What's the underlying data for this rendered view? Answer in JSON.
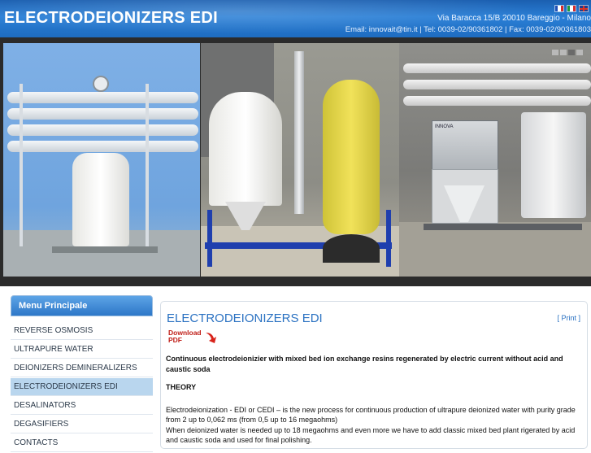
{
  "header": {
    "title": "ELECTRODEIONIZERS EDI",
    "address": "Via Baracca 15/B 20010 Bareggio - Milano",
    "contacts": "Email: innovait@tin.it  |  Tel: 0039-02/90361802  |  Fax: 0039-02/90361803",
    "languages": [
      "Français",
      "Italiano",
      "English"
    ]
  },
  "banner": {
    "slides": 4,
    "active_slide": 3,
    "plate_text": "INNOVA"
  },
  "sidebar": {
    "heading": "Menu Principale",
    "items": [
      {
        "label": "REVERSE OSMOSIS"
      },
      {
        "label": "ULTRAPURE WATER"
      },
      {
        "label": "DEIONIZERS DEMINERALIZERS"
      },
      {
        "label": "ELECTRODEIONIZERS EDI",
        "active": true
      },
      {
        "label": "DESALINATORS"
      },
      {
        "label": "DEGASIFIERS"
      },
      {
        "label": "CONTACTS"
      }
    ]
  },
  "content": {
    "title": "ELECTRODEIONIZERS EDI",
    "print_label": "[ Print ]",
    "download_label_1": "Download",
    "download_label_2": "PDF",
    "lead": "Continuous electrodeionizier with mixed bed ion exchange resins regenerated by electric current  without acid and caustic soda",
    "section_title": "THEORY",
    "paragraph_1": "Electrodeionization - EDI or CEDI – is the new process for continuous production of ultrapure deionized water with purity grade from 2 up to 0,062 ms (from 0,5 up to 16 megaohms)",
    "paragraph_2": "When deionized water is needed up to 18 megaohms and even more we have to add classic mixed bed plant rigerated by acid and caustic soda and used for final polishing."
  }
}
